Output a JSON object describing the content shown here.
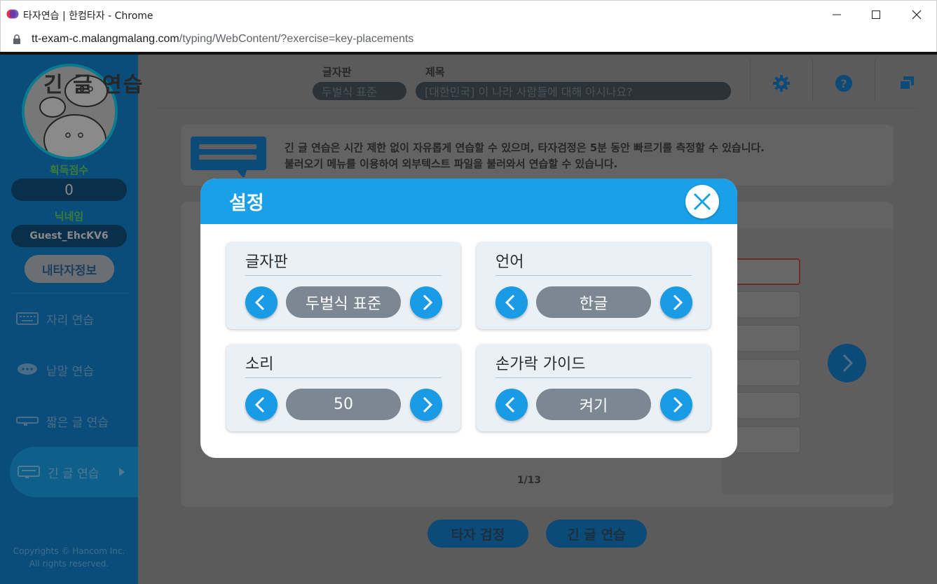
{
  "browser": {
    "tab_title": "타자연습 | 한컴타자 - Chrome",
    "url_host": "tt-exam-c.malangmalang.com",
    "url_path": "/typing/WebContent/?exercise=key-placements"
  },
  "sidebar": {
    "score_label": "획득점수",
    "score_value": "0",
    "nickname_label": "닉네임",
    "nickname_value": "Guest_EhcKV6",
    "my_info_button": "내타자정보",
    "menu": [
      {
        "label": "자리 연습",
        "icon": "keyboard-icon"
      },
      {
        "label": "낱말 연습",
        "icon": "speech-bubble-icon"
      },
      {
        "label": "짧은 글 연습",
        "icon": "short-text-icon"
      },
      {
        "label": "긴 글 연습",
        "icon": "long-text-icon"
      }
    ],
    "copyright_line1": "Copyrights © Hancom Inc.",
    "copyright_line2": "All rights reserved."
  },
  "header": {
    "title": "긴 글 연습",
    "keyboard_label": "글자판",
    "keyboard_value": "두벌식 표준",
    "subject_label": "제목",
    "subject_value": "[대한민국] 이 나라 사람들에 대해 아시나요?"
  },
  "info": {
    "line1": "긴 글 연습은 시간 제한 없이 자유롭게 연습할 수 있으며, 타자검정은 5분 동안 빠르기를 측정할 수 있습니다.",
    "line2": "불러오기 메뉴를 이용하여 외부텍스트 파일을 불러와서 연습할 수 있습니다."
  },
  "content": {
    "page_indicator": "1/13",
    "exam_button": "타자 검정",
    "long_text_button": "긴 글 연습"
  },
  "dialog": {
    "title": "설정",
    "settings": [
      {
        "label": "글자판",
        "value": "두벌식 표준"
      },
      {
        "label": "언어",
        "value": "한글"
      },
      {
        "label": "소리",
        "value": "50"
      },
      {
        "label": "손가락 가이드",
        "value": "켜기"
      }
    ]
  },
  "colors": {
    "dialog_accent": "#1aa0e8",
    "value_pill": "#7b8793",
    "overlay": "#5b5b5b"
  }
}
